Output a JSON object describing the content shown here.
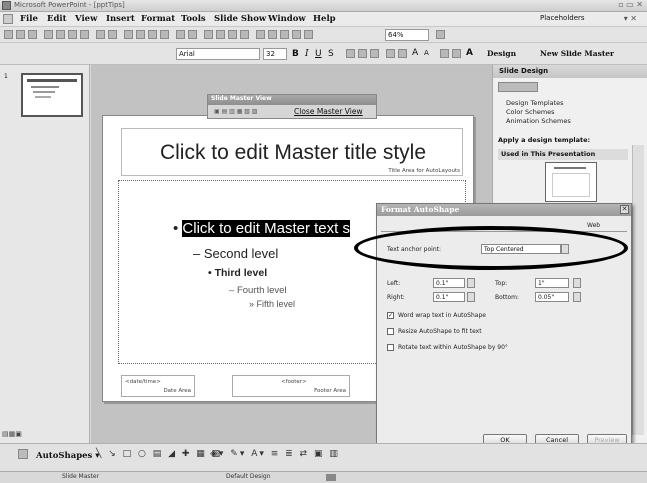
{
  "window": {
    "title": "Microsoft PowerPoint - [pptTips]"
  },
  "menu": [
    "File",
    "Edit",
    "View",
    "Insert",
    "Format",
    "Tools",
    "Slide Show",
    "Window",
    "Help"
  ],
  "toolbar": {
    "zoom": "64%",
    "font": "Arial",
    "font_size": "32",
    "design": "Design",
    "new_slide": "New Slide Master"
  },
  "view_dropdown": "Placeholders",
  "master_view": {
    "title": "Slide Master View",
    "close": "Close Master View"
  },
  "slide": {
    "title_text": "Click to edit Master title style",
    "title_area": "Title Area for AutoLayouts",
    "levels": [
      "Click to edit Master text s",
      "Second level",
      "Third level",
      "Fourth level",
      "Fifth level"
    ],
    "date_tag": "<date/time>",
    "date_area": "Date Area",
    "footer_tag": "<footer>",
    "footer_area": "Footer Area"
  },
  "task_pane": {
    "title": "Slide Design",
    "links": [
      "Design Templates",
      "Color Schemes",
      "Animation Schemes"
    ],
    "apply": "Apply a design template:",
    "used": "Used in This Presentation"
  },
  "dialog": {
    "title": "Format AutoShape",
    "tab_web": "Web",
    "anchor_label": "Text anchor point:",
    "anchor_value": "Top Centered",
    "left_label": "Left:",
    "left_val": "0.1\"",
    "top_label": "Top:",
    "top_val": "1\"",
    "right_label": "Right:",
    "right_val": "0.1\"",
    "bottom_label": "Bottom:",
    "bottom_val": "0.05\"",
    "check1": "Word wrap text in AutoShape",
    "check2": "Resize AutoShape to fit text",
    "check3": "Rotate text within AutoShape by 90°",
    "ok": "OK",
    "cancel": "Cancel",
    "preview": "Preview"
  },
  "drawbar": {
    "autoshapes": "AutoShapes"
  },
  "status": {
    "view": "Slide Master",
    "design": "Default Design"
  }
}
